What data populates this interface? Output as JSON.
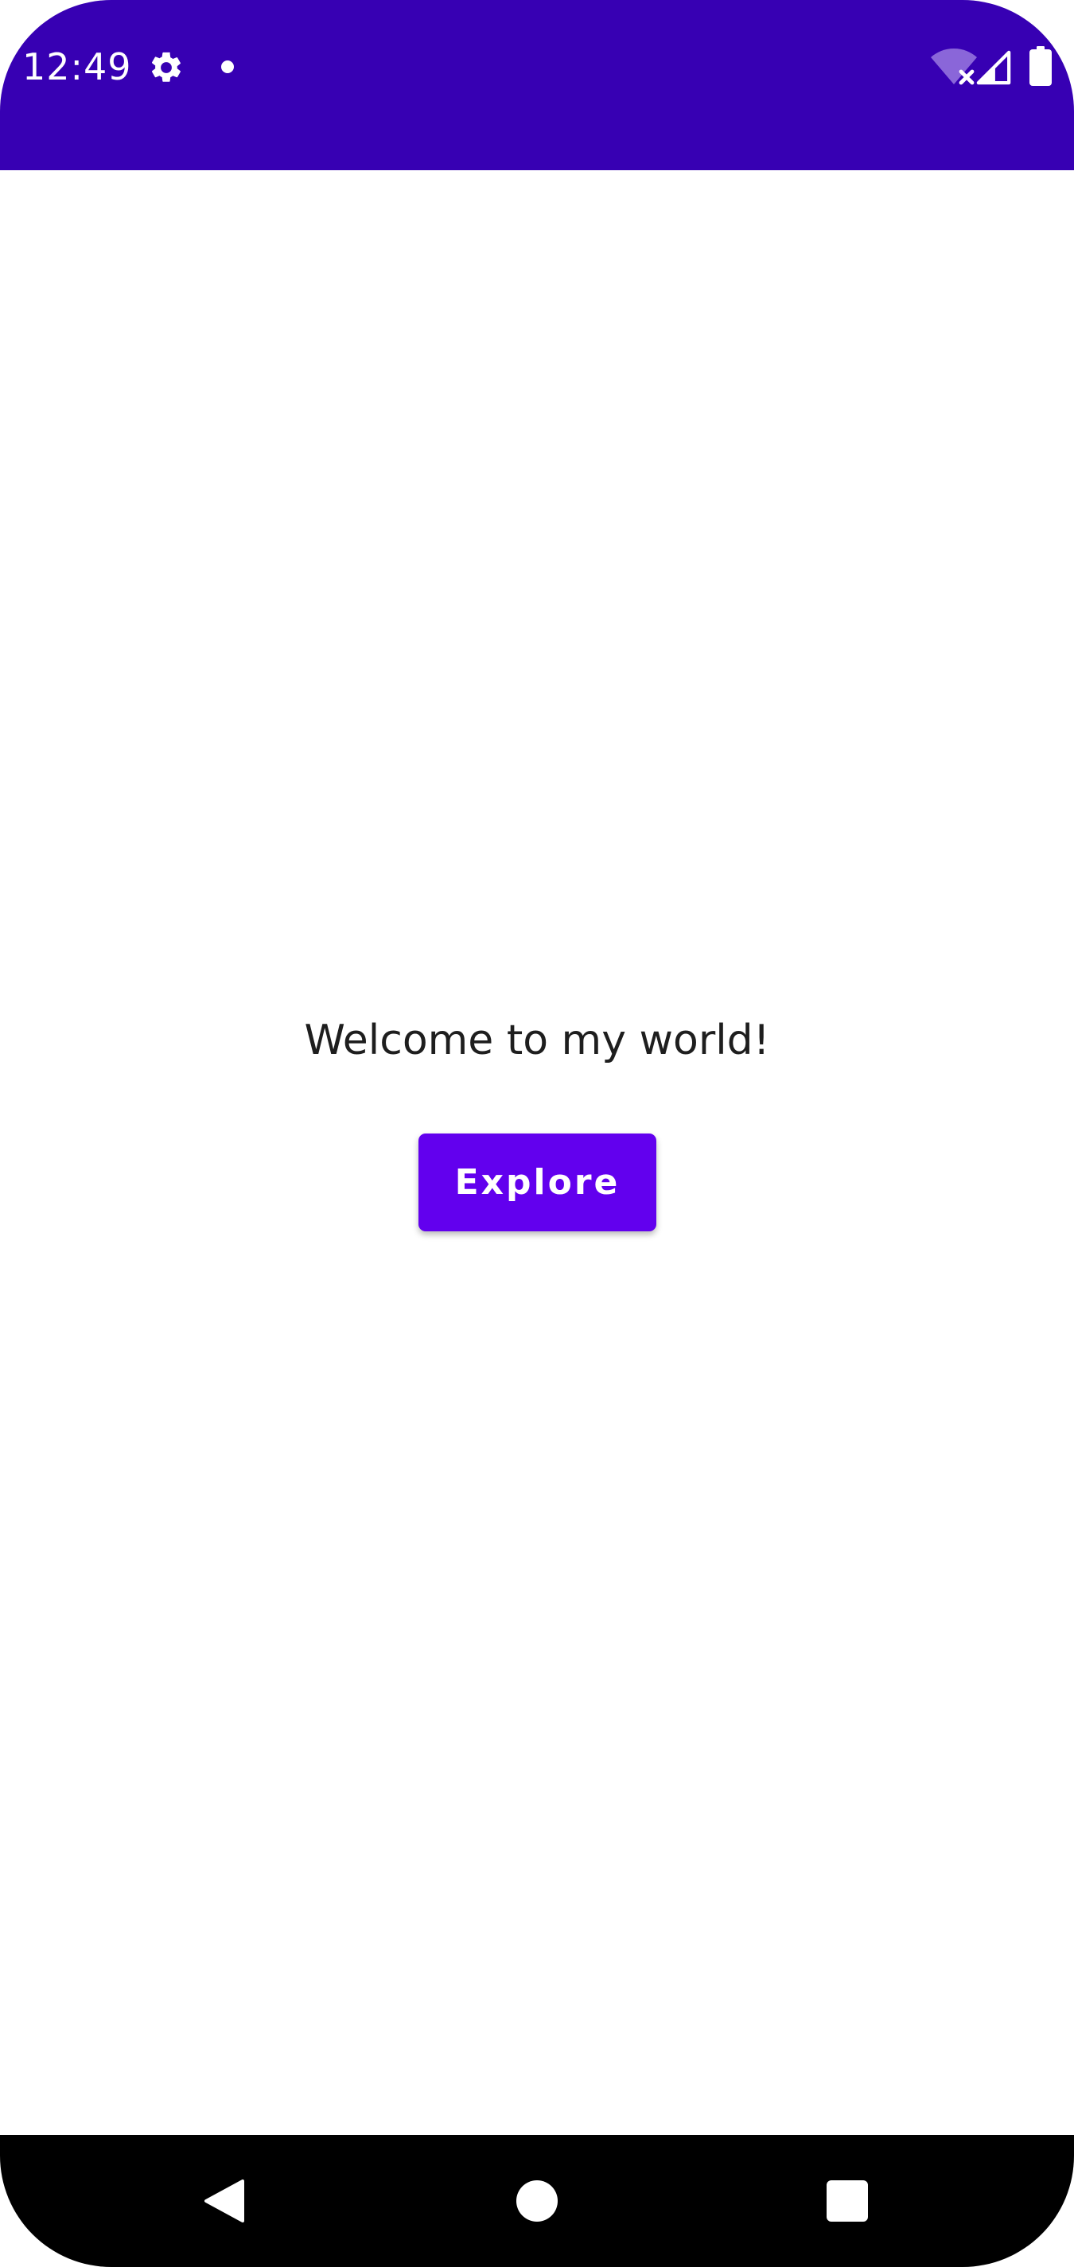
{
  "status_bar": {
    "time": "12:49",
    "icons": [
      "gear-icon",
      "dot-icon",
      "wifi-off-icon",
      "signal-icon",
      "battery-icon"
    ],
    "background_color": "#3700b3"
  },
  "main": {
    "welcome_text": "Welcome to my world!",
    "explore_button_label": "Explore",
    "button_color": "#6200ee"
  },
  "nav_bar": {
    "icons": [
      "back-icon",
      "home-icon",
      "recents-icon"
    ]
  }
}
